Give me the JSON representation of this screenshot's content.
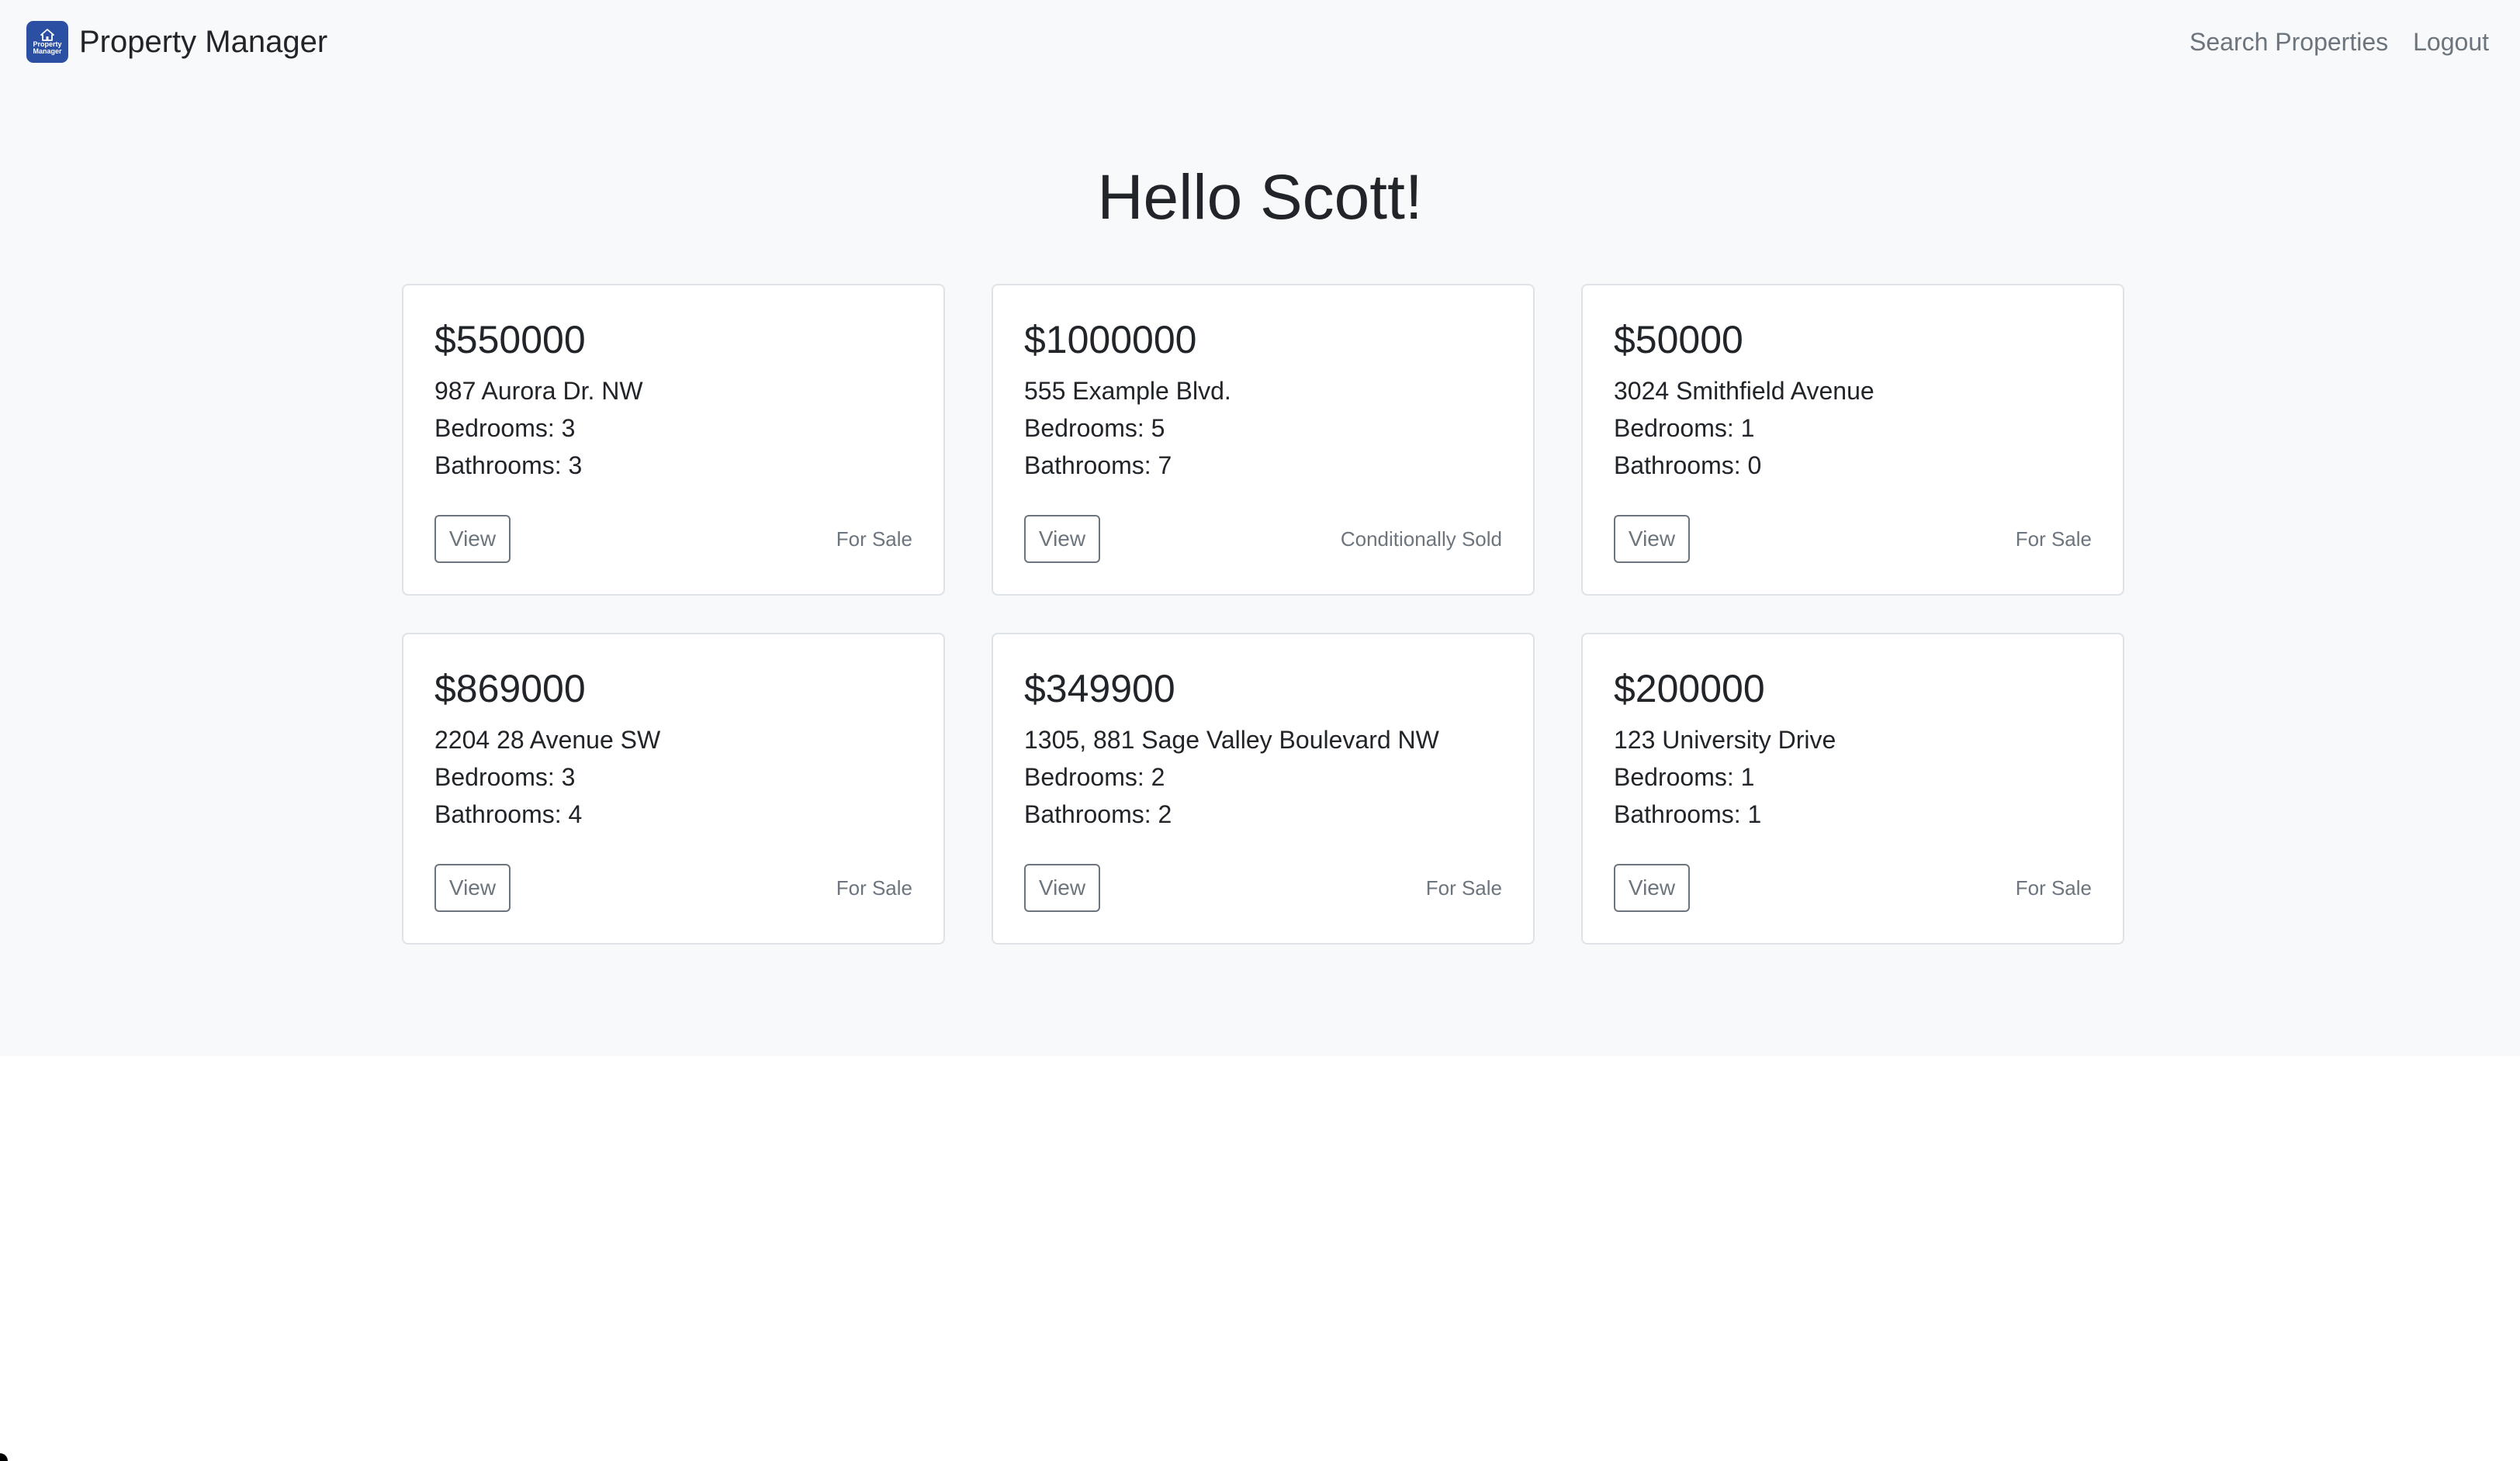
{
  "navbar": {
    "brand_name": "Property Manager",
    "logo_text_line1": "Property",
    "logo_text_line2": "Manager",
    "links": [
      "Search Properties",
      "Logout"
    ]
  },
  "main": {
    "greeting": "Hello Scott!",
    "properties": [
      {
        "price": "$550000",
        "address": "987 Aurora Dr. NW",
        "bedrooms": "Bedrooms: 3",
        "bathrooms": "Bathrooms: 3",
        "view_label": "View",
        "status": "For Sale"
      },
      {
        "price": "$1000000",
        "address": "555 Example Blvd.",
        "bedrooms": "Bedrooms: 5",
        "bathrooms": "Bathrooms: 7",
        "view_label": "View",
        "status": "Conditionally Sold"
      },
      {
        "price": "$50000",
        "address": "3024 Smithfield Avenue",
        "bedrooms": "Bedrooms: 1",
        "bathrooms": "Bathrooms: 0",
        "view_label": "View",
        "status": "For Sale"
      },
      {
        "price": "$869000",
        "address": "2204 28 Avenue SW",
        "bedrooms": "Bedrooms: 3",
        "bathrooms": "Bathrooms: 4",
        "view_label": "View",
        "status": "For Sale"
      },
      {
        "price": "$349900",
        "address": "1305, 881 Sage Valley Boulevard NW",
        "bedrooms": "Bedrooms: 2",
        "bathrooms": "Bathrooms: 2",
        "view_label": "View",
        "status": "For Sale"
      },
      {
        "price": "$200000",
        "address": "123 University Drive",
        "bedrooms": "Bedrooms: 1",
        "bathrooms": "Bathrooms: 1",
        "view_label": "View",
        "status": "For Sale"
      }
    ]
  },
  "icons": {
    "logo": "house-logo-icon"
  },
  "colors": {
    "page_background": "#f8f9fa",
    "logo_background": "#2b4fa3",
    "muted_text": "#6c757d",
    "card_border": "#dfe2e6"
  }
}
